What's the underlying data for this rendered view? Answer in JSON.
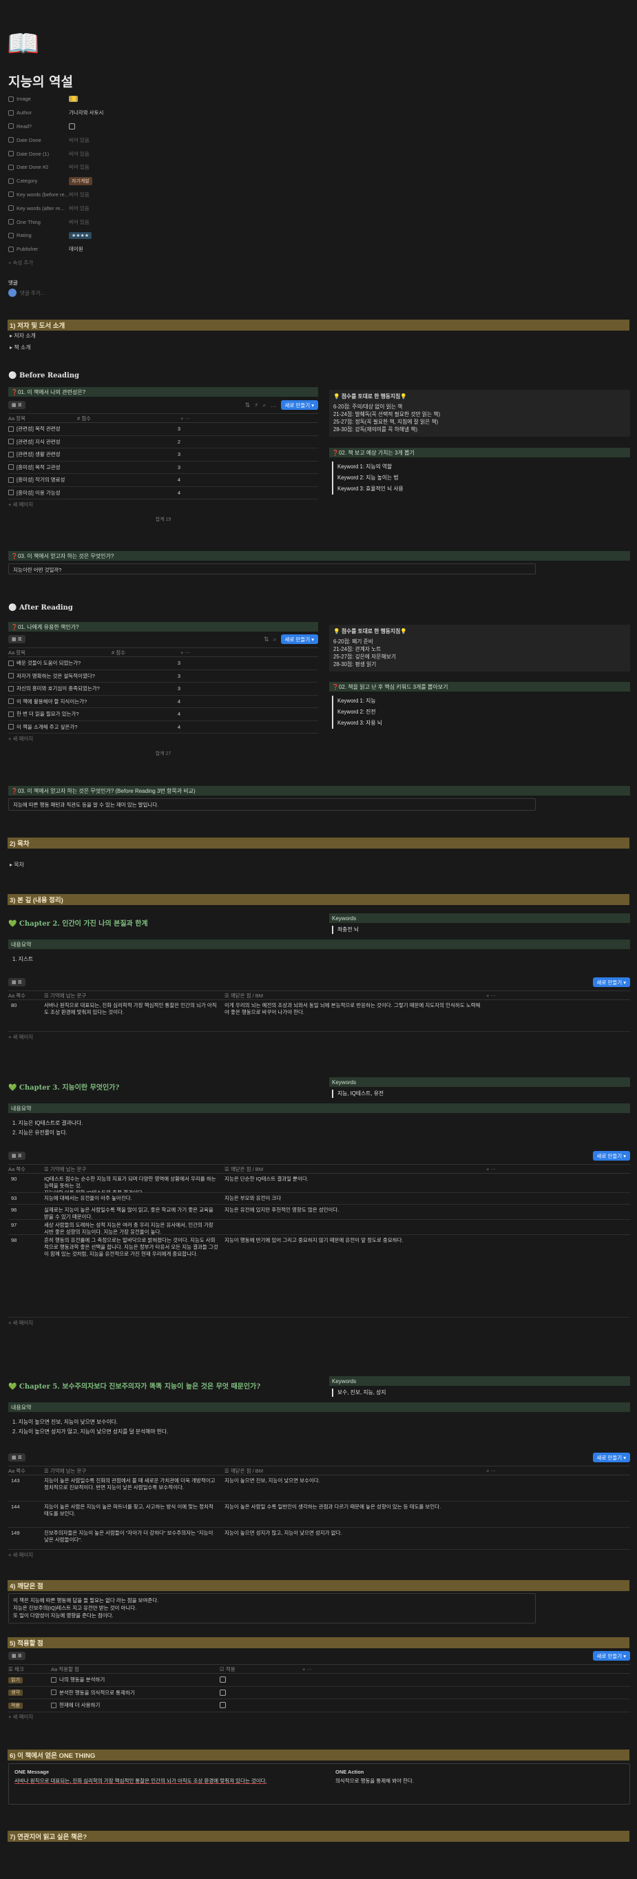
{
  "page": {
    "icon": "book-icon",
    "title": "지능의 역설"
  },
  "properties": [
    {
      "name": "Image",
      "value": "📒",
      "kind": "image"
    },
    {
      "name": "Author",
      "value": "가나자와 사토시",
      "kind": "text"
    },
    {
      "name": "Read?",
      "value": "",
      "kind": "checkbox"
    },
    {
      "name": "Date Done",
      "value": "비어 있음",
      "kind": "empty"
    },
    {
      "name": "Date Done (1)",
      "value": "비어 있음",
      "kind": "empty"
    },
    {
      "name": "Date Done #2",
      "value": "비어 있음",
      "kind": "empty"
    },
    {
      "name": "Category",
      "value": "자기계발",
      "kind": "tag"
    },
    {
      "name": "Key words (before re...",
      "value": "비어 있음",
      "kind": "empty"
    },
    {
      "name": "Key words (after re...",
      "value": "비어 있음",
      "kind": "empty"
    },
    {
      "name": "One Thing",
      "value": "비어 있음",
      "kind": "empty"
    },
    {
      "name": "Rating",
      "value": "★★★★",
      "kind": "rating"
    },
    {
      "name": "Publisher",
      "value": "데이원",
      "kind": "text"
    }
  ],
  "add_property": "+ 속성 추가",
  "comments": {
    "label": "댓글",
    "placeholder": "댓글 추가..."
  },
  "sections": {
    "s1": "1) 저자 및 도서 소개",
    "s1_items": [
      "저자 소개",
      "책 소개"
    ],
    "before_reading": "Before Reading",
    "s2": "2) 목차",
    "s2_item": "목차",
    "s3": "3) 본 깊 (내용 정리)",
    "s4": "4) 깨닫은 점",
    "s5": "5) 적용할 점",
    "s6": "6) 이 책에서 얻은 ONE THING",
    "s7": "7) 연관지어 읽고 싶은 책은?",
    "after_reading": "After Reading"
  },
  "before": {
    "callout": "❓01. 이 책에서 나의 관련성은?",
    "view": "표",
    "col1": "항목",
    "col2": "점수",
    "rows": [
      [
        "[관련성] 목적 관련성",
        "3"
      ],
      [
        "[관련성] 지식 관련성",
        "2"
      ],
      [
        "[관련성] 생활 관련성",
        "3"
      ],
      [
        "[흥미성] 목적 고관성",
        "3"
      ],
      [
        "[흥미성] 작가의 명료성",
        "4"
      ],
      [
        "[흥미성] 이용 가능성",
        "4"
      ]
    ],
    "new_page": "+ 새 페이지",
    "sum": "합계 19",
    "score_title": "💡 점수를 토대로 한 행동지침💡",
    "score_lines": [
      "6-20점: 주의/대상 없이 읽는 책",
      "21-24점: 발췌독(꼭 선택적 필요한 것만 읽는 책)",
      "25-27점: 정독(꼭 필요한 책, 지침에 잘 읽은 책)",
      "28-30점: 강독(재의미를 꼭 하해낼 책)"
    ],
    "q2": "❓02. 책 보고 예상 가치는 3개 뽑기",
    "keywords": [
      "Keyword 1: 지능의 역할",
      "Keyword 2: 지능 높이는 법",
      "Keyword 3: 효율적인 뇌 사용"
    ],
    "q3": "❓03. 이 책에서 얻고자 하는 것은 무엇인가?",
    "q3_answer": "지능이란 어떤 것일까?"
  },
  "after": {
    "callout": "❓01. 나에게 유용한 책인가?",
    "col1": "항목",
    "col2": "점수",
    "rows": [
      [
        "배운 것들이 도움이 되었는가?",
        "3"
      ],
      [
        "저자가 명확하는 것은 설득적이였다?",
        "3"
      ],
      [
        "자신의 흥미와 호기심이 충족되었는가?",
        "3"
      ],
      [
        "이 책에 활용해야 할 지식이는가?",
        "4"
      ],
      [
        "한 번 더 읽을 필요가 있는가?",
        "4"
      ],
      [
        "이 책을 소개해 주고 싶은가?",
        "4"
      ]
    ],
    "sum": "합계 27",
    "score_lines": [
      "6-20점: 폐기 준비",
      "21-24점: 관계자 노트",
      "25-27점: 깊은에 자문해보기",
      "28-30점: 평생 읽기"
    ],
    "q2": "❓02. 책을 읽고 난 후 핵심 키워드 3개를 뽑아보기",
    "keywords": [
      "Keyword 1: 지능",
      "Keyword 2: 진전",
      "Keyword 3: 자용 뇌"
    ],
    "q3": "❓03. 이 책에서 얻고자 하는 것은 무엇인가? (Before Reading 3번 항목과 비교)",
    "q3_answer": "지능에 따른 행동 패턴과 직관도 등을 알 수 있는 재미 있는 말입니다."
  },
  "chapters": [
    {
      "title": "💚 Chapter 2. 인간이 가진 나의 본질과 한계",
      "keyword_label": "Keywords",
      "keywords": "좌충전 뇌",
      "summary_label": "내용요약",
      "summary": [
        "지스트"
      ],
      "rows": [
        [
          "80",
          "사바나 원칙으로 대표되는, 진화 심리학적 가장 핵심적인 통찰은 인간의 뇌가 아직도 조상 환경에 맞춰져 있다는 것이다.",
          "이게 우리의 뇌는 예전의 조상과 뇌와서 동일 뇌에 본능적으로 반응하는 것이다. 그렇기 때문에 지도자의 인식하도 노력해야 좋은 행동으로 바꾸어 나가야 한다."
        ]
      ]
    },
    {
      "title": "💚 Chapter 3. 지능이란 무엇인가?",
      "keyword_label": "Keywords",
      "keywords": "지능, IQ테스트, 유전",
      "summary_label": "내용요약",
      "summary": [
        "지능은 IQ테스트로 결과나다.",
        "지능은 유전률이 높다."
      ],
      "rows": [
        [
          "90",
          "IQ테스트 점수는 순수한 지능의 지표가 되며 다양한 영역에 상황에서 우리를 하는 능력을 뜻하는 것.\n지능이란 이를 위한 IQ테스트의 측정 결과이다.",
          "지능은 단순한 IQ테스트 결과일 뿐이다."
        ],
        [
          "93",
          "지능에 대해서는 유전율이 아주 높아진다.",
          "지능은 부모와 유전이 크다"
        ],
        [
          "96",
          "실제로는 지능이 높은 사람일수록 책을 많이 읽고, 좋은 학교에 가기 좋은 교육을 받을 수 있기 때문이다.",
          "지능은 유전에 있지만 후천적인 영향도 많은 성인이다."
        ],
        [
          "97",
          "세상 사람들의 도례하는 성적 지능은 여러 종 우리 지능은 유사에서, 인간의 가장 시반 좋은 성향의 지능이다. 지능은 가장 유전율이 높다.",
          ""
        ],
        [
          "98",
          "흔히 행동의 유전률에 그 측정으로는 밑바닥으로 밝혀졌다는 것이다. 지능도 사회적으로 행동과학 좋은 선택을 합니다. 지능은 정부가 타유서 모든 지능 결과들 그것이 함께 있는 것처럼, 지능을 유전적으로 가진 현재 우리에게 중요합니다.",
          "지능이 행동에 반기에 있어 그리고 중요하지 않기 때문에 유전이 앞 정도로 중요하다."
        ]
      ]
    },
    {
      "title": "💚 Chapter 5. 보수주의자보다 진보주의자가 똑똑 지능이 높은 것은 무엇 때문인가?",
      "keyword_label": "Keywords",
      "keywords": "보수, 진보, 지능, 성지",
      "summary_label": "내용요약",
      "summary": [
        "지능이 높으면 진보, 지능이 낮으면 보수이다.",
        "지능이 높으면 성지가 많고, 지능이 낮으면 성지를 덜 분석해야 한다."
      ],
      "rows": [
        [
          "143",
          "지능이 높은 사람일수록 진화의 관점에서 볼 때 새로운 가치관에 더욱 개방적이고 정치적으로 진보적이다. 반면 지능이 낮은 사람일수록 보수적이다.",
          "지능이 높으면 진보, 지능이 낮으면 보수이다."
        ],
        [
          "144",
          "지능이 높은 사람은 지능이 높은 파트너를 찾고, 사고하는 방식 이에 맞는 정치적 태도를 보인다.",
          "지능이 높은 사람일 수록 일반인이 생각하는 관점과 다르기 때문에 높은 성향이 있는 등 태도를 보인다."
        ],
        [
          "149",
          "진보주의자들은 지능이 높은 사람들이 \"자아가 더 강하다\" 보수주의자는 \"지능이 낮은 사람들이다\".",
          "지능이 높으면 성지가 많고, 지능이 낮으면 성지가 없다."
        ]
      ]
    }
  ],
  "chapter_cols": {
    "page": "쪽수",
    "quote": "기억에 남는 문구",
    "thought": "깨닫은 점 / BM"
  },
  "insight": [
    "이 책은 지능에 따른 행동에 답을 들 필요는 없다 라는 점을 보여준다.",
    "지능은 진보주의(IQ)테스트 지고 유전만 받는 것이 아니다.",
    "또 일이 다양성이 지능에 영향을 준다는 점이다."
  ],
  "apply": {
    "cols": [
      "체크",
      "적용할 점",
      "적용"
    ],
    "rows": [
      [
        "읽기",
        "나의 행동을 분석하기"
      ],
      [
        "생각",
        "분석한 행동을 의식적으로 통제하기"
      ],
      [
        "적용",
        "현재에 더 사용하기"
      ]
    ]
  },
  "one_thing": {
    "message_label": "ONE Message",
    "message": "사바나 원칙으로 대표되는, 진화 심리학의 가장 핵심적인 통찰은 인간의 뇌가 아직도 조상 환경에 맞춰져 있다는 것이다.",
    "action_label": "ONE Action",
    "action": "의식적으로 행동을 통제해 봐야 한다."
  },
  "ui": {
    "new_button": "새로 만들기",
    "sum_label": "합계",
    "new_page": "+ 새 페이지"
  },
  "colors": {
    "section": "#6b5a2e",
    "callout": "#2a3a2e",
    "accent": "#2f7ee8"
  }
}
